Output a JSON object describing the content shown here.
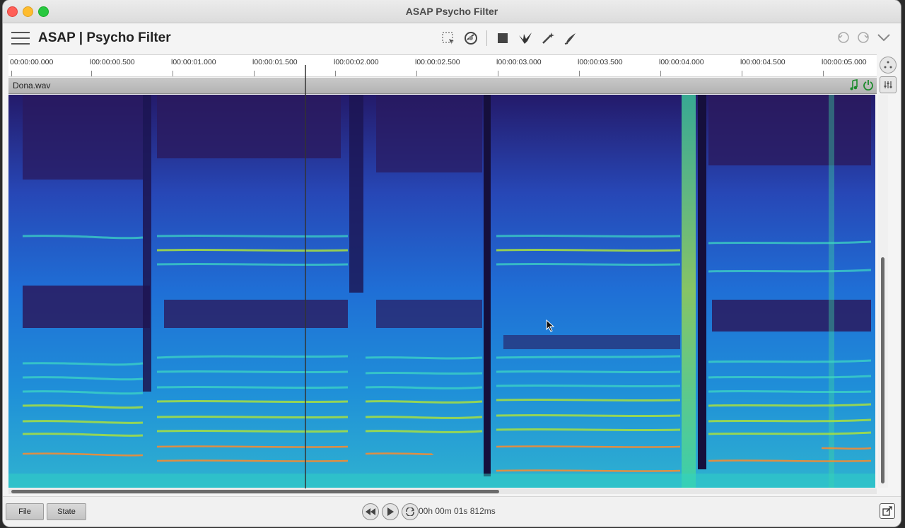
{
  "window": {
    "title": "ASAP Psycho Filter"
  },
  "app": {
    "title": "ASAP | Psycho Filter"
  },
  "toolbar": {
    "tools": [
      "selection-tool-icon",
      "spot-heal-icon",
      "rectangle-tool-icon",
      "bird-icon",
      "magic-wand-icon",
      "brush-icon"
    ]
  },
  "ruler": {
    "ticks": [
      "00:00:00.000",
      "l00:00:00.500",
      "l00:00:01.000",
      "l00:00:01.500",
      "l00:00:02.000",
      "l00:00:02.500",
      "l00:00:03.000",
      "l00:00:03.500",
      "l00:00:04.000",
      "l00:00:04.500",
      "l00:00:05.000"
    ]
  },
  "track": {
    "name": "Dona.wav"
  },
  "bottom": {
    "file_label": "File",
    "state_label": "State",
    "time": "00h 00m 01s 812ms"
  },
  "colors": {
    "low": "#2a1a5e",
    "mid": "#1f6fd6",
    "high": "#2fd2c4",
    "peak": "#d8e43a",
    "hot": "#ff8a2a"
  }
}
